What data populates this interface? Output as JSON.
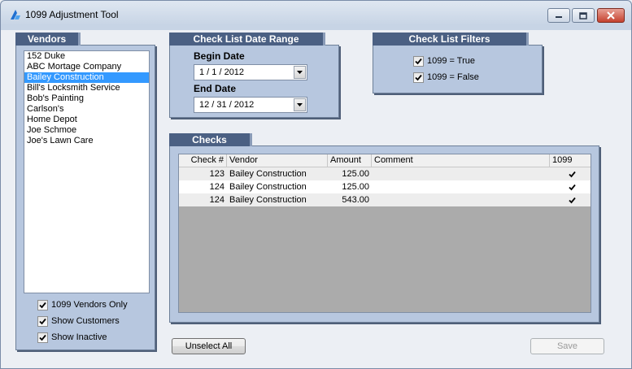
{
  "window": {
    "title": "1099 Adjustment Tool"
  },
  "vendors": {
    "header": "Vendors",
    "items": [
      {
        "label": "152 Duke",
        "selected": false
      },
      {
        "label": "ABC Mortage Company",
        "selected": false
      },
      {
        "label": "Bailey Construction",
        "selected": true
      },
      {
        "label": "Bill's Locksmith Service",
        "selected": false
      },
      {
        "label": "Bob's Painting",
        "selected": false
      },
      {
        "label": "Carlson's",
        "selected": false
      },
      {
        "label": "Home Depot",
        "selected": false
      },
      {
        "label": "Joe Schmoe",
        "selected": false
      },
      {
        "label": "Joe's Lawn Care",
        "selected": false
      }
    ],
    "options": [
      {
        "label": "1099 Vendors Only",
        "checked": true
      },
      {
        "label": "Show Customers",
        "checked": true
      },
      {
        "label": "Show Inactive",
        "checked": true
      }
    ]
  },
  "date_range": {
    "header": "Check List Date Range",
    "begin_label": "Begin Date",
    "begin_value": "1 / 1 / 2012",
    "end_label": "End Date",
    "end_value": "12 / 31 / 2012"
  },
  "filters": {
    "header": "Check List Filters",
    "items": [
      {
        "label": "1099 = True",
        "checked": true
      },
      {
        "label": "1099 = False",
        "checked": true
      }
    ]
  },
  "checks": {
    "header": "Checks",
    "columns": [
      "Check #",
      "Vendor",
      "Amount",
      "Comment",
      "1099"
    ],
    "rows": [
      {
        "check_no": "123",
        "vendor": "Bailey Construction",
        "amount": "125.00",
        "comment": "",
        "is_1099": true
      },
      {
        "check_no": "124",
        "vendor": "Bailey Construction",
        "amount": "125.00",
        "comment": "",
        "is_1099": true
      },
      {
        "check_no": "124",
        "vendor": "Bailey Construction",
        "amount": "543.00",
        "comment": "",
        "is_1099": true
      }
    ]
  },
  "buttons": {
    "unselect_all": "Unselect All",
    "save": "Save"
  },
  "colors": {
    "group_bg": "#b7c7df",
    "header_bg": "#4b6083",
    "selection": "#3399ff",
    "grid_empty": "#ababab"
  },
  "icons": {
    "app": "app-logo-icon",
    "minimize": "minimize-icon",
    "maximize": "maximize-icon",
    "close": "close-icon",
    "dropdown": "chevron-down-icon",
    "check": "checkmark-icon"
  }
}
